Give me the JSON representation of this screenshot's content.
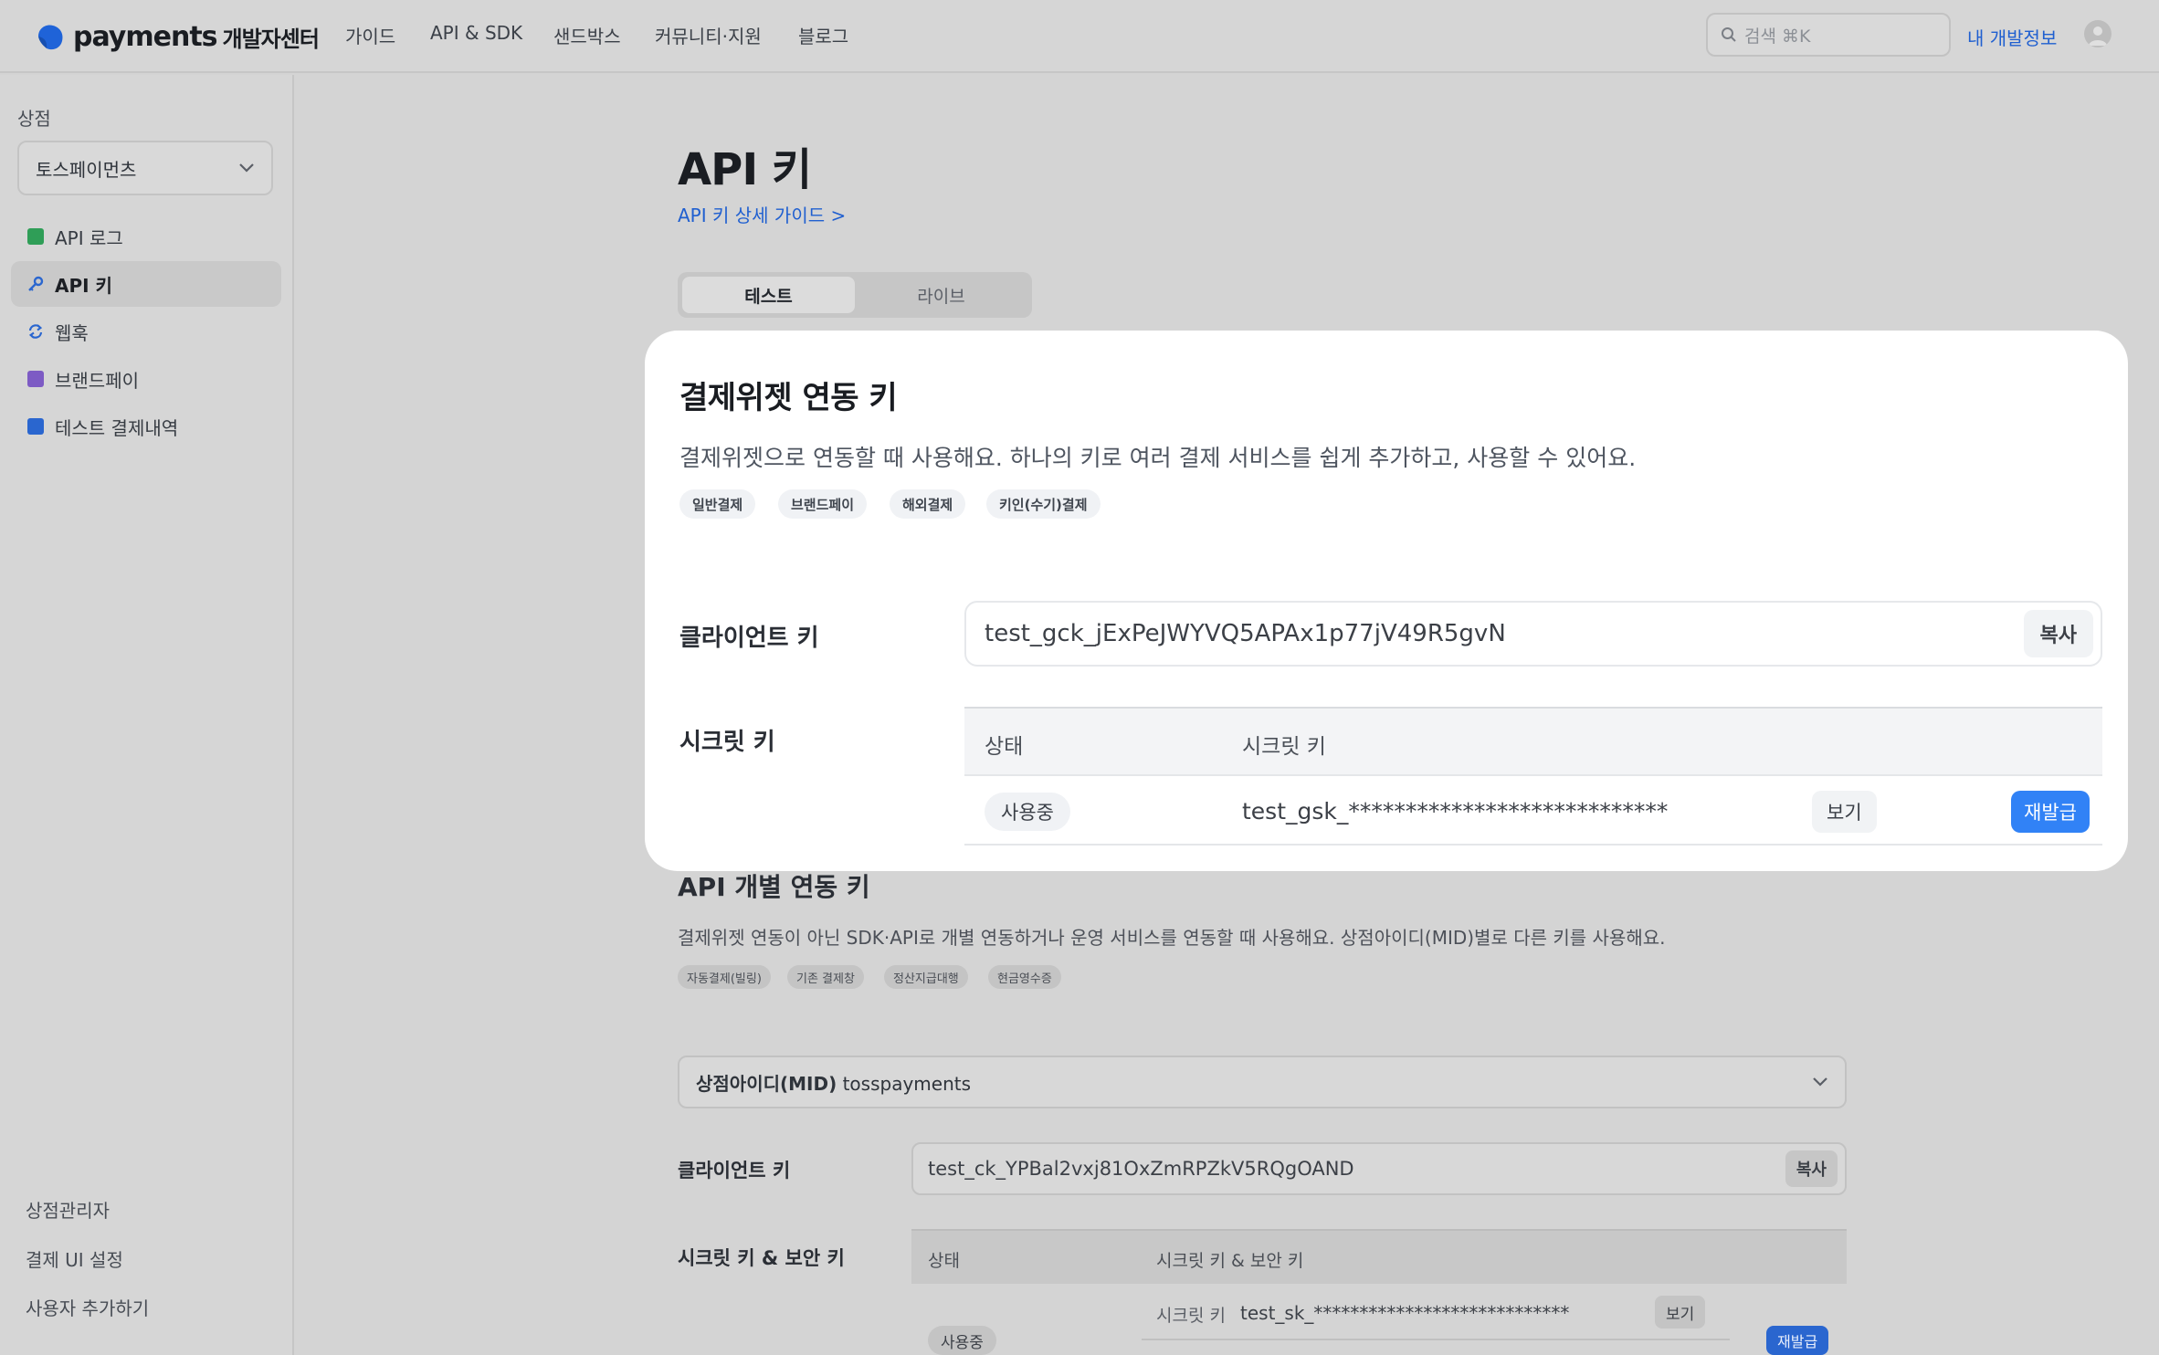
{
  "header": {
    "logo_word": "payments",
    "logo_sub": "개발자센터",
    "nav": [
      "가이드",
      "API & SDK",
      "샌드박스",
      "커뮤니티·지원",
      "블로그"
    ],
    "search_placeholder": "검색 ⌘K",
    "my_dev_info": "내 개발정보"
  },
  "sidebar": {
    "section_title": "상점",
    "store_selected": "토스페이먼츠",
    "items": [
      {
        "label": "API 로그",
        "icon": "log-book-icon"
      },
      {
        "label": "API 키",
        "icon": "key-icon"
      },
      {
        "label": "웹훅",
        "icon": "refresh-icon"
      },
      {
        "label": "브랜드페이",
        "icon": "brandpay-icon"
      },
      {
        "label": "테스트 결제내역",
        "icon": "receipt-icon"
      }
    ],
    "bottom_links": [
      "상점관리자",
      "결제 UI 설정",
      "사용자 추가하기"
    ]
  },
  "main": {
    "title": "API 키",
    "guide_link": "API 키 상세 가이드 >",
    "tabs": [
      "테스트",
      "라이브"
    ]
  },
  "widget_card": {
    "title": "결제위젯 연동 키",
    "description": "결제위젯으로 연동할 때 사용해요. 하나의 키로 여러 결제 서비스를 쉽게 추가하고, 사용할 수 있어요.",
    "chips": [
      "일반결제",
      "브랜드페이",
      "해외결제",
      "키인(수기)결제"
    ],
    "client_key_label": "클라이언트 키",
    "client_key": "test_gck_jExPeJWYVQ5APAx1p77jV49R5gvN",
    "copy_label": "복사",
    "secret_key_label": "시크릿 키",
    "table_headers": [
      "상태",
      "시크릿 키"
    ],
    "row": {
      "status": "사용중",
      "secret": "test_gsk_****************************",
      "view_label": "보기",
      "reissue_label": "재발급"
    }
  },
  "api_section": {
    "title": "API 개별 연동 키",
    "description": "결제위젯 연동이 아닌 SDK·API로 개별 연동하거나 운영 서비스를 연동할 때 사용해요. 상점아이디(MID)별로 다른 키를 사용해요.",
    "chips": [
      "자동결제(빌링)",
      "기존 결제창",
      "정산지급대행",
      "현금영수증"
    ],
    "mid_label": "상점아이디(MID)",
    "mid_value": "tosspayments",
    "client_key_label": "클라이언트 키",
    "client_key": "test_ck_YPBal2vxj81OxZmRPZkV5RQgOAND",
    "copy_label": "복사",
    "secret_label": "시크릿 키 & 보안 키",
    "table_headers": [
      "상태",
      "시크릿 키 & 보안 키"
    ],
    "row": {
      "status": "사용중",
      "secret_label": "시크릿 키",
      "secret": "test_sk_****************************",
      "view_label": "보기",
      "reissue_label": "재발급"
    }
  },
  "colors": {
    "primary_blue": "#3182f6",
    "link_blue": "#1f5fd0",
    "overlay_gray": "#d4d4d4"
  }
}
